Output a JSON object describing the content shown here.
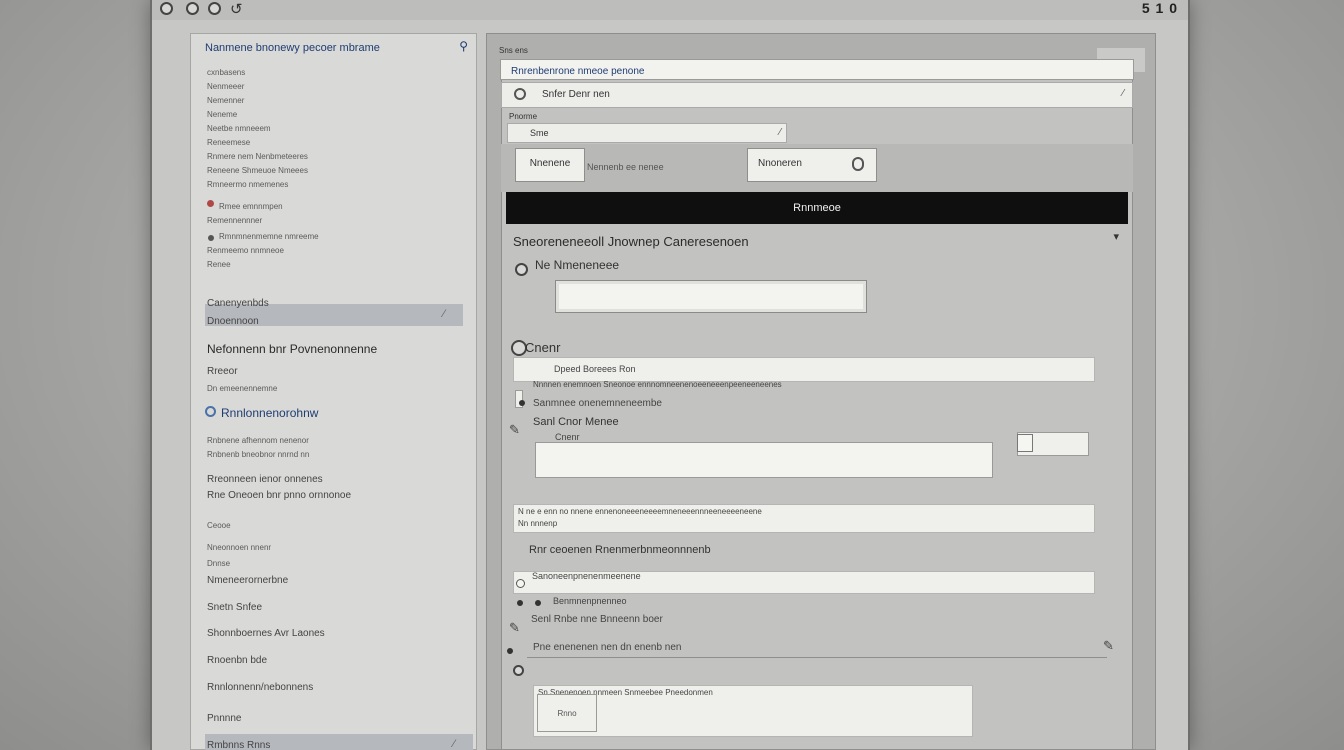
{
  "titlebar": {
    "arrow_icon": "refresh-icon",
    "controls": "5 1 0"
  },
  "sidebar": {
    "header": "Nanmene bnonewy pecoer mbrame",
    "header_icon": "pin-icon",
    "items": [
      "cxnbasens",
      "Nenmeeer",
      "Nemenner",
      "Neneme",
      "Neetbe nmneeem",
      "Reneemese",
      "Rnmere nem Nenbmeteeres",
      "Reneene Shmeuoe Nmeees",
      "Rmneermo nmemenes",
      "Rmee emnnmpen",
      "Remennennner",
      "Rmnmnenmemne nmreeme",
      "Renmeemo nnmneoe",
      "Renee"
    ],
    "selected_title": "Canenyenbds",
    "selected_sub": "Dnoennoon",
    "big_items": [
      "Nefonnenn bnr Povnenonnenne",
      "Rreeor",
      "Dn emeenennemne",
      "Rnnlonnenorohnw",
      "Rnbnene afhennom nenenor",
      "Rnbnenb bneobnor nnrnd nn",
      "Rreonneen ienor onnenes",
      "Rne Oneoen bnr pnno ornnonoe",
      "Ceooe",
      "Nneonnoen nnenr",
      "Dnnse",
      "Nmeneerornerbne",
      "Snetn    Snfee",
      "Shonnboernes    Avr Laones",
      "Rnoenbn bde",
      "Rnnlonnenn/nebonnens",
      "Pnnnne",
      "Rmbnns Rnns"
    ]
  },
  "main": {
    "label": "Sns ens",
    "bar_title": "Rnrenbenrone nmeoe penone",
    "search_text": "Snfer Denr nen",
    "small_label": "Pnorme",
    "dropdown_value": "Sme",
    "btn_left": "Nnenene",
    "btn_left_aside": "Nennenb ee nenee",
    "btn_right": "Nnoneren",
    "black_bar": "Rnnmeoe",
    "section_title": "Sneoreneneeoll Jnownep Caneresenoen",
    "row1_label": "Ne Nmeneneee",
    "row2_label": "Cnenr",
    "row2_field": "Dpeed  Boreees  Ron",
    "row2_sub": "Nnnnen enemnoen Sneonoe ennnomneenenoeeneeenpeeneeneenes",
    "row3_text": "Sanmnee onenemneneembe",
    "row4_label": "Sanl  Cnor Menee",
    "row4_sub": "Cnenr",
    "row5_text": "N ne   e  enn  no  nnene  ennenoneeeneeeemneneeennneeneeeeneene",
    "row5_sub": "Nn nnnenp",
    "row6_label": "Rnr ceoenen Rnenmerbnmeonnnenb",
    "row7_text": "Sanoneenpnenenmeenene",
    "row8_text": "Benmnenpnenneo",
    "row9_text": "Senl  Rnbe  nne  Bnneenn boer",
    "row10_text": "Pne  enenenen nen dn enenb nen",
    "row11_text": "Sn Snenenoen  nnmeen  Snmeebee  Pneedonmen",
    "row11_btn": "Rnno"
  },
  "colors": {
    "accent": "#1f3d73",
    "black_bar": "#0f0f0f",
    "selection": "#b5b8bd",
    "window": "#c7c7c5"
  }
}
